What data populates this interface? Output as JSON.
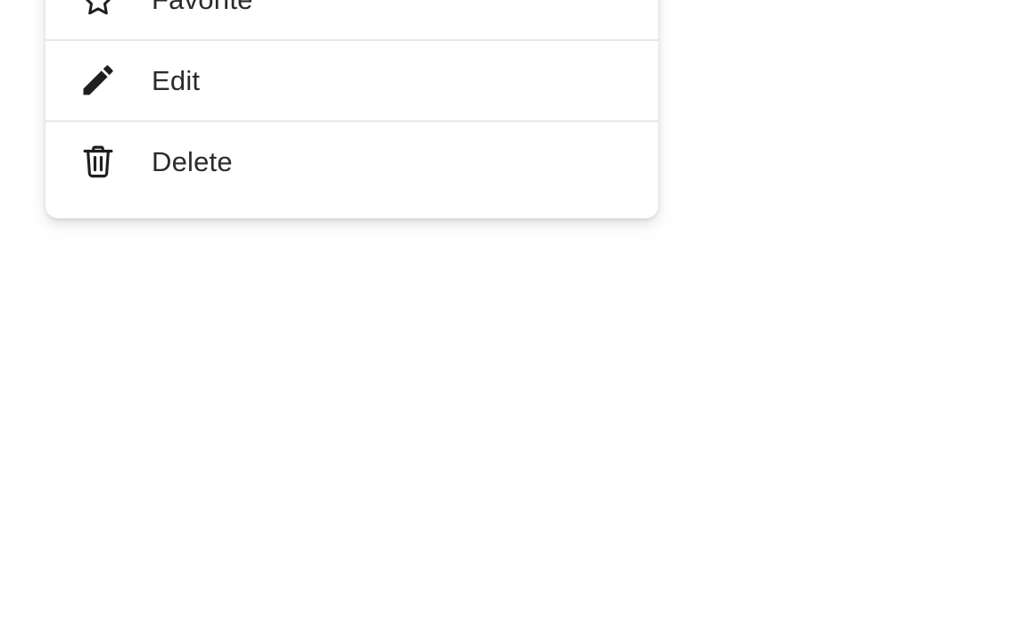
{
  "context_menu": {
    "items": [
      {
        "label": "Favorite",
        "icon": "star-outline-icon"
      },
      {
        "label": "Edit",
        "icon": "pencil-icon"
      },
      {
        "label": "Delete",
        "icon": "trash-icon"
      }
    ]
  },
  "colors": {
    "text": "#2b2b2b",
    "icon": "#1f1f1f",
    "divider": "#e8e8e8",
    "menu_background": "#ffffff",
    "page_background": "#fefefe"
  }
}
